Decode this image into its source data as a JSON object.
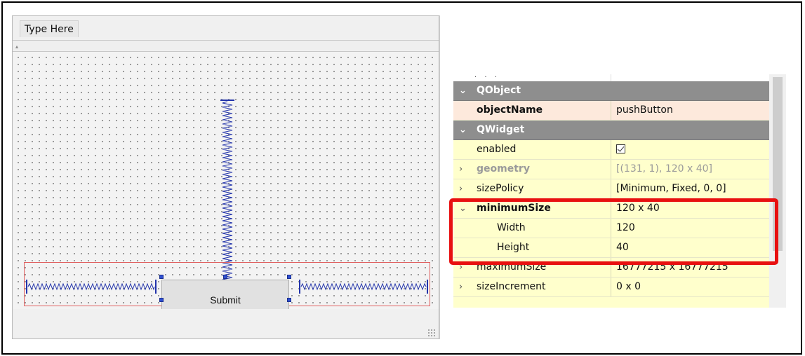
{
  "designer": {
    "menubar": {
      "item_label": "Type Here"
    },
    "button": {
      "label": "Submit"
    }
  },
  "property_editor": {
    "top_dots": ". . .",
    "categories": {
      "qobject": "QObject",
      "qwidget": "QWidget"
    },
    "rows": {
      "objectName": {
        "name": "objectName",
        "value": "pushButton"
      },
      "enabled": {
        "name": "enabled",
        "checked": true
      },
      "geometry": {
        "name": "geometry",
        "value": "[(131, 1), 120 x 40]"
      },
      "sizePolicy": {
        "name": "sizePolicy",
        "value": "[Minimum, Fixed, 0, 0]"
      },
      "minimumSize": {
        "name": "minimumSize",
        "value": "120 x 40"
      },
      "width": {
        "name": "Width",
        "value": "120"
      },
      "height": {
        "name": "Height",
        "value": "40"
      },
      "maximumSize": {
        "name": "maximumSize",
        "value": "16777215 x 16777215"
      },
      "sizeIncrement": {
        "name": "sizeIncrement",
        "value": "0 x 0"
      }
    },
    "icons": {
      "expanded": "chevron-down-icon",
      "collapsed": "chevron-right-icon"
    }
  },
  "colors": {
    "category_bg": "#8e8e8e",
    "object_row_bg": "#fde9dc",
    "widget_row_bg": "#ffffcc",
    "highlight": "#e81010",
    "selection_handle": "#2f4fd0",
    "layout_border": "#e06060"
  }
}
